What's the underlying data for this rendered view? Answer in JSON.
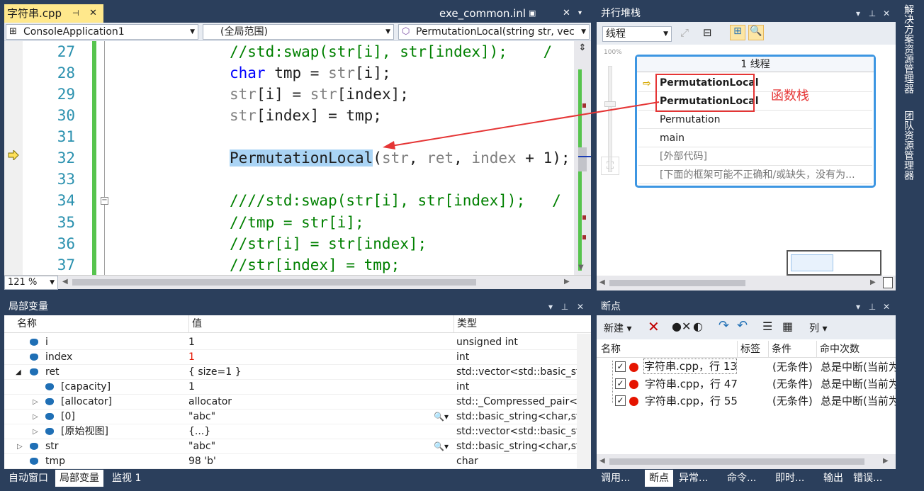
{
  "editor": {
    "tabs": [
      {
        "label": "字符串.cpp"
      },
      {
        "label": "exe_common.inl"
      }
    ],
    "project_combo": "ConsoleApplication1",
    "scope_combo": "(全局范围)",
    "function_combo": "PermutationLocal(string str, vec",
    "zoom": "121 %",
    "lines": [
      {
        "num": "27",
        "text": "//std:swap(str[i], str[index]);    /"
      },
      {
        "num": "28",
        "text": "char tmp = str[i];"
      },
      {
        "num": "29",
        "text": "str[i] = str[index];"
      },
      {
        "num": "30",
        "text": "str[index] = tmp;"
      },
      {
        "num": "31",
        "text": ""
      },
      {
        "num": "32",
        "text": "PermutationLocal(str, ret, index + 1);"
      },
      {
        "num": "33",
        "text": ""
      },
      {
        "num": "34",
        "text": "////std:swap(str[i], str[index]);   /"
      },
      {
        "num": "35",
        "text": "//tmp = str[i];"
      },
      {
        "num": "36",
        "text": "//str[i] = str[index];"
      },
      {
        "num": "37",
        "text": "//str[index] = tmp;"
      }
    ]
  },
  "parallel": {
    "title": "并行堆栈",
    "combo": "线程",
    "zoom_label": "100%",
    "header": "1 线程",
    "frames": [
      "PermutationLocal",
      "PermutationLocal",
      "Permutation",
      "main",
      "[外部代码]",
      "[下面的框架可能不正确和/或缺失，没有为..."
    ],
    "annotation": "函数栈"
  },
  "locals": {
    "title": "局部变量",
    "columns": [
      "名称",
      "值",
      "类型"
    ],
    "rows": [
      {
        "name": "i",
        "value": "1",
        "type": "unsigned int"
      },
      {
        "name": "index",
        "value": "1",
        "type": "int"
      },
      {
        "name": "ret",
        "value": "{ size=1 }",
        "type": "std::vector<std::basic_strin"
      },
      {
        "name": "[capacity]",
        "value": "1",
        "type": "int"
      },
      {
        "name": "[allocator]",
        "value": "allocator",
        "type": "std::_Compressed_pair<st"
      },
      {
        "name": "[0]",
        "value": "\"abc\"",
        "type": "std::basic_string<char,std"
      },
      {
        "name": "[原始视图]",
        "value": "{...}",
        "type": "std::vector<std::basic_strin"
      },
      {
        "name": "str",
        "value": "\"abc\"",
        "type": "std::basic_string<char,std"
      },
      {
        "name": "tmp",
        "value": "98 'b'",
        "type": "char"
      }
    ],
    "tabs": [
      "自动窗口",
      "局部变量",
      "监视 1"
    ]
  },
  "breakpoints": {
    "title": "断点",
    "new_label": "新建",
    "columns_label": "列",
    "columns": [
      "名称",
      "标签",
      "条件",
      "命中次数"
    ],
    "rows": [
      {
        "name": "字符串.cpp，行 13",
        "cond": "(无条件)",
        "hits": "总是中断(当前为"
      },
      {
        "name": "字符串.cpp，行 47",
        "cond": "(无条件)",
        "hits": "总是中断(当前为"
      },
      {
        "name": "字符串.cpp，行 55",
        "cond": "(无条件)",
        "hits": "总是中断(当前为"
      }
    ],
    "tabs": [
      "调用...",
      "断点",
      "异常...",
      "命令...",
      "即时...",
      "输出",
      "错误..."
    ]
  },
  "side": {
    "tab1": "解决方案资源管理器",
    "tab2": "团队资源管理器"
  },
  "colors": {
    "accent": "#2b3f5c",
    "tab_yellow": "#ffe88c",
    "red": "#e51400"
  }
}
